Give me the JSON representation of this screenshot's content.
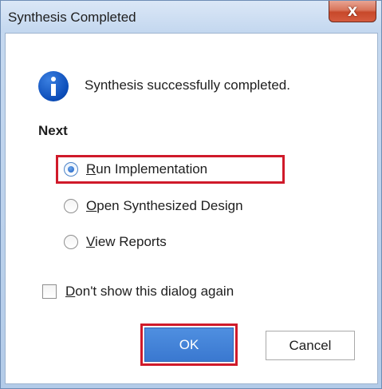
{
  "window": {
    "title": "Synthesis Completed",
    "close_glyph": "X"
  },
  "message": "Synthesis successfully completed.",
  "next_section": {
    "label": "Next",
    "options": [
      {
        "mnemonic": "R",
        "rest": "un Implementation",
        "checked": true
      },
      {
        "mnemonic": "O",
        "rest": "pen Synthesized Design",
        "checked": false
      },
      {
        "mnemonic": "V",
        "rest": "iew Reports",
        "checked": false
      }
    ]
  },
  "dont_show": {
    "mnemonic": "D",
    "rest": "on't show this dialog again",
    "checked": false
  },
  "buttons": {
    "ok": "OK",
    "cancel": "Cancel"
  },
  "colors": {
    "highlight": "#d01a2a",
    "ok_button": "#3a78d0",
    "info_icon": "#0b4cb8"
  },
  "icons": {
    "info": "info-icon",
    "close": "close-icon"
  }
}
